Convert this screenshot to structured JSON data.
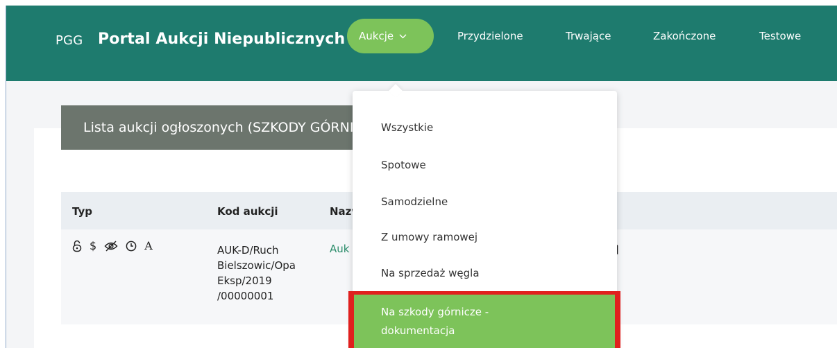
{
  "header": {
    "brand_prefix": "PGG",
    "brand_title": "Portal Aukcji Niepublicznych",
    "nav": {
      "active_label": "Aukcje",
      "links": [
        "Przydzielone",
        "Trwające",
        "Zakończone",
        "Testowe"
      ]
    }
  },
  "dropdown": {
    "items": [
      "Wszystkie",
      "Spotowe",
      "Samodzielne",
      "Z umowy ramowej",
      "Na sprzedaż węgla"
    ],
    "highlighted": {
      "line1": "Na szkody górnicze -",
      "line2": "dokumentacja"
    }
  },
  "page": {
    "list_title": "Lista aukcji ogłoszonych (SZKODY GÓRNICZE)"
  },
  "table": {
    "columns": [
      "Typ",
      "Kod aukcji",
      "Nazwa"
    ],
    "row": {
      "icons": [
        "padlock-icon",
        "dollar-icon",
        "eye-slash-icon",
        "clock-icon",
        "letter-a-icon"
      ],
      "icon_a_text": "A",
      "icon_dollar_text": "$",
      "code_lines": [
        "AUK-D/Ruch",
        "Bielszowic/Opa",
        "Eksp/2019",
        "/00000001"
      ],
      "name_fragment": "Auk"
    }
  },
  "colors": {
    "header_bg": "#1e7b6e",
    "accent_green": "#7dc35a",
    "highlight_border": "#e0201e",
    "list_header_bg": "#6c756d"
  }
}
